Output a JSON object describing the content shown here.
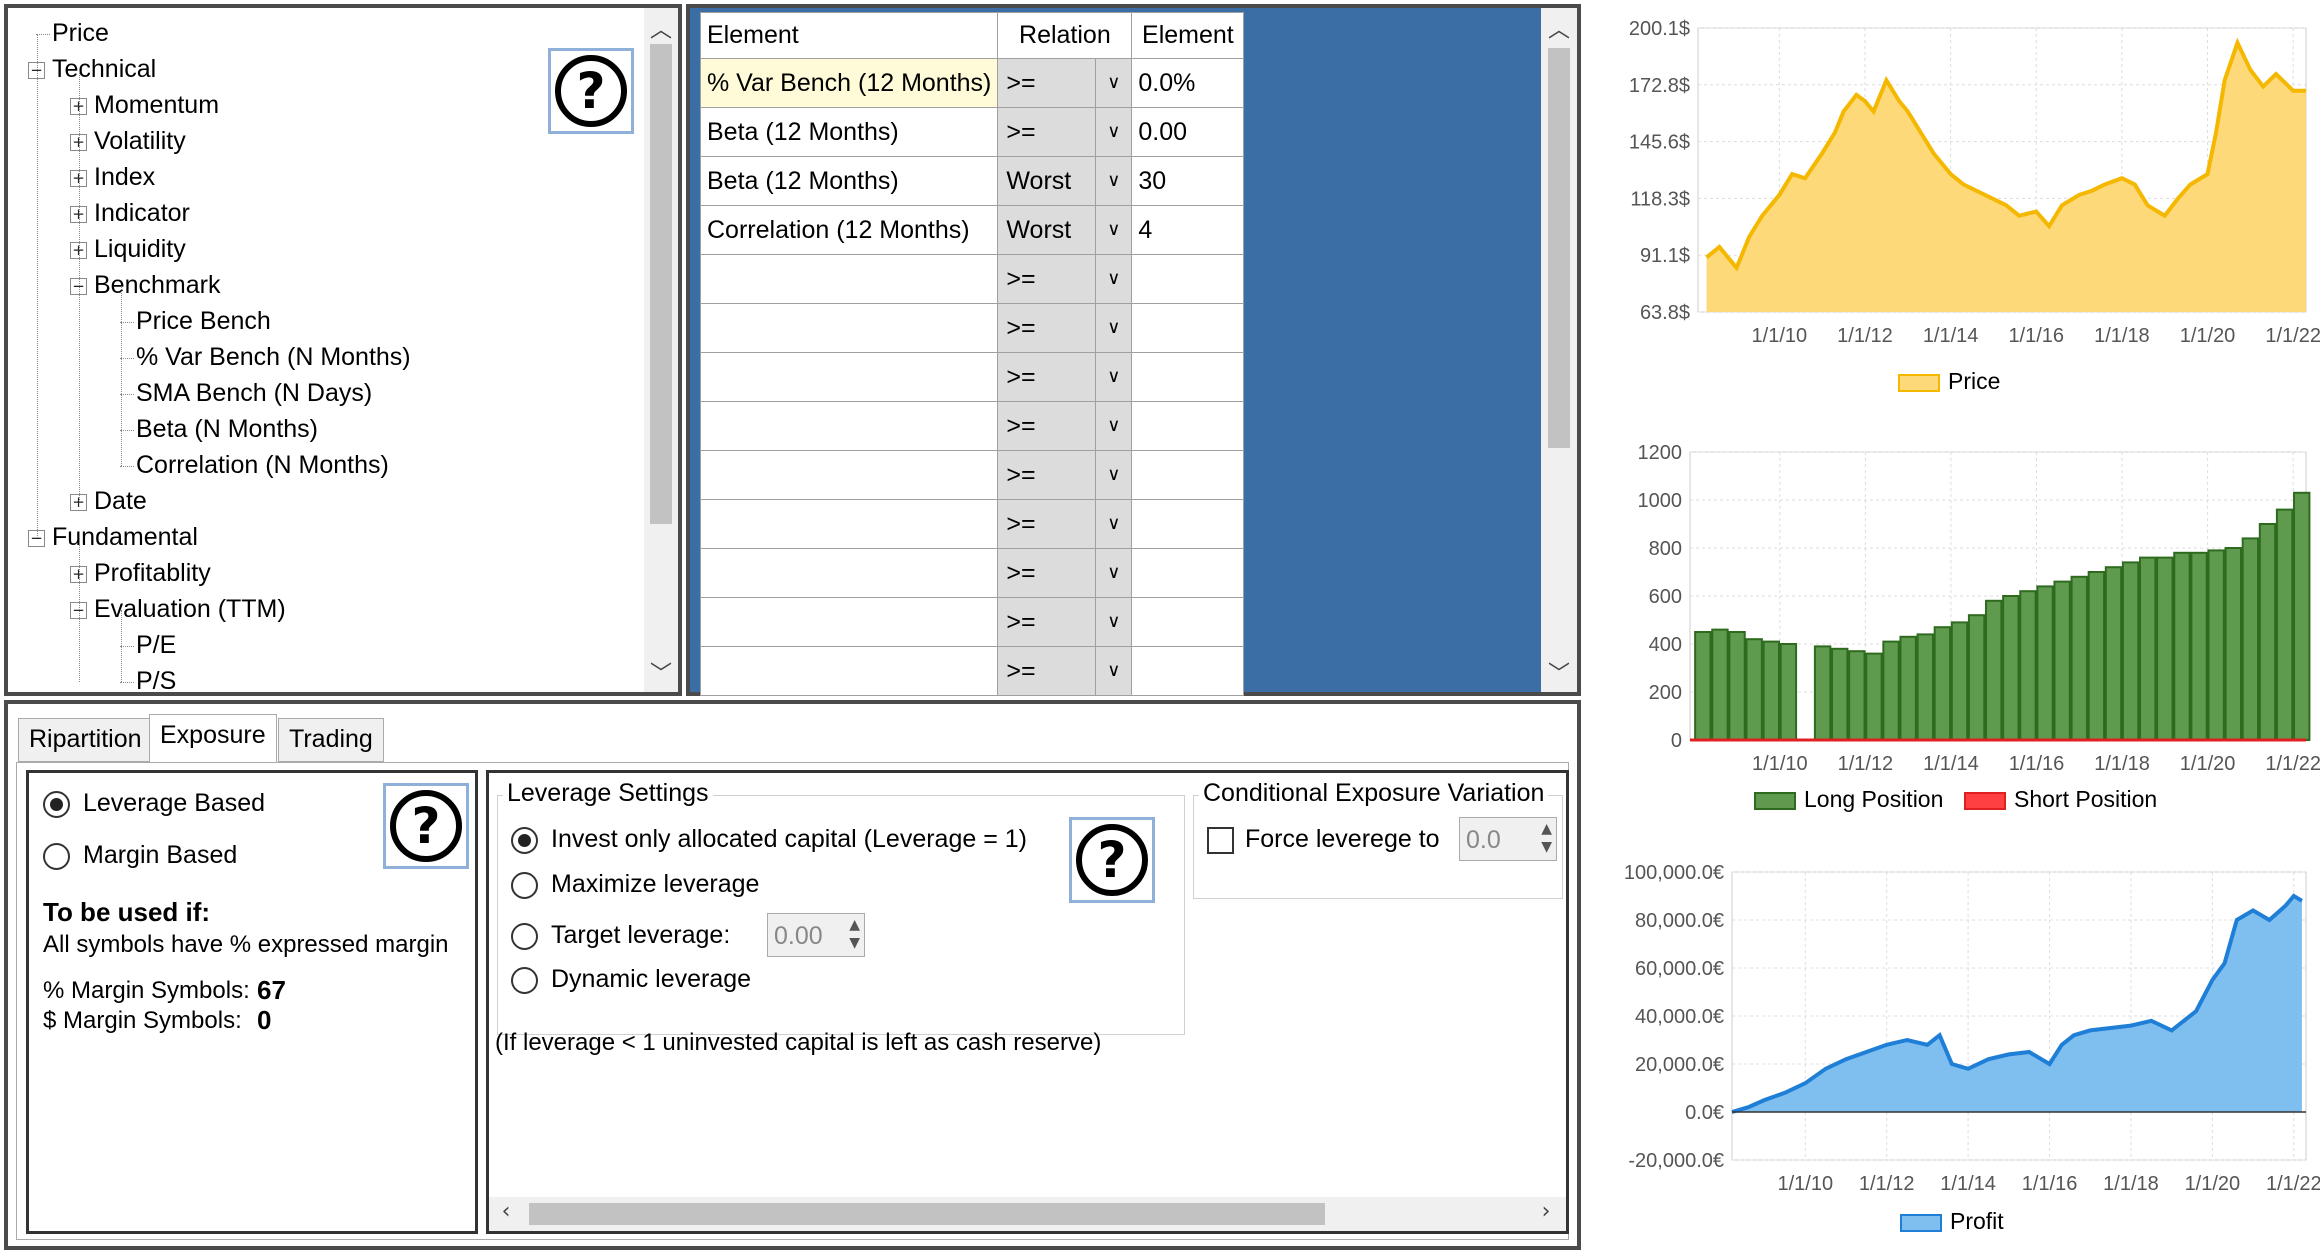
{
  "tree": {
    "items": [
      {
        "label": "Price",
        "level": 0,
        "expander": "none"
      },
      {
        "label": "Technical",
        "level": 0,
        "expander": "minus"
      },
      {
        "label": "Momentum",
        "level": 1,
        "expander": "plus"
      },
      {
        "label": "Volatility",
        "level": 1,
        "expander": "plus"
      },
      {
        "label": "Index",
        "level": 1,
        "expander": "plus"
      },
      {
        "label": "Indicator",
        "level": 1,
        "expander": "plus"
      },
      {
        "label": "Liquidity",
        "level": 1,
        "expander": "plus"
      },
      {
        "label": "Benchmark",
        "level": 1,
        "expander": "minus"
      },
      {
        "label": "Price Bench",
        "level": 2,
        "expander": "none"
      },
      {
        "label": "% Var Bench (N Months)",
        "level": 2,
        "expander": "none"
      },
      {
        "label": "SMA Bench (N Days)",
        "level": 2,
        "expander": "none"
      },
      {
        "label": "Beta (N Months)",
        "level": 2,
        "expander": "none"
      },
      {
        "label": "Correlation (N Months)",
        "level": 2,
        "expander": "none"
      },
      {
        "label": "Date",
        "level": 1,
        "expander": "plus"
      },
      {
        "label": "Fundamental",
        "level": 0,
        "expander": "minus"
      },
      {
        "label": "Profitablity",
        "level": 1,
        "expander": "plus"
      },
      {
        "label": "Evaluation (TTM)",
        "level": 1,
        "expander": "minus"
      },
      {
        "label": "P/E",
        "level": 2,
        "expander": "none"
      },
      {
        "label": "P/S",
        "level": 2,
        "expander": "none"
      }
    ],
    "help": "?"
  },
  "grid": {
    "headers": [
      "Element",
      "Relation",
      "Element"
    ],
    "rows": [
      {
        "element": "% Var Bench (12 Months)",
        "relation": ">=",
        "value": "0.0%"
      },
      {
        "element": "Beta (12 Months)",
        "relation": ">=",
        "value": "0.00"
      },
      {
        "element": "Beta (12 Months)",
        "relation": "Worst",
        "value": "30"
      },
      {
        "element": "Correlation (12 Months)",
        "relation": "Worst",
        "value": "4"
      },
      {
        "element": "",
        "relation": ">=",
        "value": ""
      },
      {
        "element": "",
        "relation": ">=",
        "value": ""
      },
      {
        "element": "",
        "relation": ">=",
        "value": ""
      },
      {
        "element": "",
        "relation": ">=",
        "value": ""
      },
      {
        "element": "",
        "relation": ">=",
        "value": ""
      },
      {
        "element": "",
        "relation": ">=",
        "value": ""
      },
      {
        "element": "",
        "relation": ">=",
        "value": ""
      },
      {
        "element": "",
        "relation": ">=",
        "value": ""
      },
      {
        "element": "",
        "relation": ">=",
        "value": ""
      }
    ],
    "highlight_color": "#fffbd8",
    "bg_color": "#3a6ea5"
  },
  "tabs": [
    "Ripartition",
    "Exposure",
    "Trading"
  ],
  "exposure": {
    "mode_options": [
      {
        "label": "Leverage Based",
        "checked": true
      },
      {
        "label": "Margin Based",
        "checked": false
      }
    ],
    "to_be_used_title": "To be used if:",
    "to_be_used_text": "All symbols have % expressed margin",
    "pct_margin_label": "% Margin Symbols:",
    "pct_margin_value": "67",
    "usd_margin_label": "$ Margin Symbols:",
    "usd_margin_value": "0",
    "leverage_settings_title": "Leverage Settings",
    "leverage_options": [
      {
        "label": "Invest only allocated capital (Leverage = 1)",
        "checked": true
      },
      {
        "label": "Maximize leverage",
        "checked": false
      },
      {
        "label": "Target leverage:",
        "checked": false
      },
      {
        "label": "Dynamic leverage",
        "checked": false
      }
    ],
    "target_leverage_value": "0.00",
    "note": "(If leverage < 1 uninvested capital is left as cash reserve)",
    "conditional_title": "Conditional Exposure Variation",
    "force_leverage_label": "Force leverege to",
    "force_leverage_value": "0.0"
  },
  "charts_text": {
    "price_legend": "Price",
    "long_legend": "Long Position",
    "short_legend": "Short Position",
    "profit_legend": "Profit"
  },
  "chart_data": [
    {
      "type": "area",
      "x_ticks": [
        "1/1/10",
        "1/1/12",
        "1/1/14",
        "1/1/16",
        "1/1/18",
        "1/1/20",
        "1/1/22"
      ],
      "y_ticks": [
        "63.8$",
        "91.1$",
        "118.3$",
        "145.6$",
        "172.8$",
        "200.1$"
      ],
      "ylim": [
        63.8,
        200.1
      ],
      "series": [
        {
          "name": "Price",
          "color": "#f5b800",
          "fill": "#fdd97a",
          "x": [
            2008.3,
            2008.6,
            2009.0,
            2009.3,
            2009.6,
            2010.0,
            2010.3,
            2010.6,
            2011.0,
            2011.3,
            2011.5,
            2011.8,
            2012.0,
            2012.2,
            2012.5,
            2012.8,
            2013.0,
            2013.3,
            2013.6,
            2014.0,
            2014.3,
            2014.6,
            2015.0,
            2015.3,
            2015.6,
            2016.0,
            2016.3,
            2016.6,
            2017.0,
            2017.3,
            2017.6,
            2018.0,
            2018.3,
            2018.6,
            2019.0,
            2019.3,
            2019.6,
            2020.0,
            2020.2,
            2020.4,
            2020.7,
            2021.0,
            2021.3,
            2021.6,
            2022.0,
            2022.3
          ],
          "y": [
            90,
            95,
            85,
            100,
            110,
            120,
            130,
            128,
            140,
            150,
            160,
            168,
            165,
            160,
            175,
            165,
            160,
            150,
            140,
            130,
            125,
            122,
            118,
            115,
            110,
            112,
            105,
            115,
            120,
            122,
            125,
            128,
            125,
            115,
            110,
            118,
            125,
            130,
            150,
            175,
            193,
            180,
            172,
            178,
            170,
            170
          ]
        }
      ]
    },
    {
      "type": "bar",
      "x_ticks": [
        "1/1/10",
        "1/1/12",
        "1/1/14",
        "1/1/16",
        "1/1/18",
        "1/1/20",
        "1/1/22"
      ],
      "y_ticks": [
        "0",
        "200",
        "400",
        "600",
        "800",
        "1000",
        "1200"
      ],
      "ylim": [
        0,
        1200
      ],
      "series": [
        {
          "name": "Long Position",
          "color": "#2e6b1e",
          "fill": "#5f9a4f",
          "x": [
            2008.2,
            2008.6,
            2009.0,
            2009.4,
            2009.8,
            2010.2,
            2011.0,
            2011.4,
            2011.8,
            2012.2,
            2012.6,
            2013.0,
            2013.4,
            2013.8,
            2014.2,
            2014.6,
            2015.0,
            2015.4,
            2015.8,
            2016.2,
            2016.6,
            2017.0,
            2017.4,
            2017.8,
            2018.2,
            2018.6,
            2019.0,
            2019.4,
            2019.8,
            2020.2,
            2020.6,
            2021.0,
            2021.4,
            2021.8,
            2022.2
          ],
          "y": [
            450,
            460,
            450,
            420,
            410,
            400,
            390,
            380,
            370,
            360,
            410,
            430,
            440,
            470,
            490,
            520,
            580,
            600,
            620,
            640,
            660,
            680,
            700,
            720,
            740,
            760,
            760,
            780,
            780,
            790,
            800,
            840,
            900,
            960,
            1030
          ]
        },
        {
          "name": "Short Position",
          "color": "#e02020",
          "fill": "#ff4040",
          "x": [],
          "y": []
        }
      ]
    },
    {
      "type": "area",
      "x_ticks": [
        "1/1/10",
        "1/1/12",
        "1/1/14",
        "1/1/16",
        "1/1/18",
        "1/1/20",
        "1/1/22"
      ],
      "y_ticks": [
        "-20,000.0€",
        "0.0€",
        "20,000.0€",
        "40,000.0€",
        "60,000.0€",
        "80,000.0€",
        "100,000.0€"
      ],
      "ylim": [
        -20000,
        100000
      ],
      "series": [
        {
          "name": "Profit",
          "color": "#1f7fd6",
          "fill": "#7fbff0",
          "x": [
            2008.2,
            2008.6,
            2009.0,
            2009.5,
            2010.0,
            2010.5,
            2011.0,
            2011.5,
            2012.0,
            2012.5,
            2013.0,
            2013.3,
            2013.6,
            2014.0,
            2014.5,
            2015.0,
            2015.5,
            2016.0,
            2016.3,
            2016.6,
            2017.0,
            2017.5,
            2018.0,
            2018.5,
            2019.0,
            2019.3,
            2019.6,
            2020.0,
            2020.3,
            2020.6,
            2021.0,
            2021.4,
            2021.8,
            2022.0,
            2022.2
          ],
          "y": [
            0,
            2000,
            5000,
            8000,
            12000,
            18000,
            22000,
            25000,
            28000,
            30000,
            28000,
            32000,
            20000,
            18000,
            22000,
            24000,
            25000,
            20000,
            28000,
            32000,
            34000,
            35000,
            36000,
            38000,
            34000,
            38000,
            42000,
            55000,
            62000,
            80000,
            84000,
            80000,
            86000,
            90000,
            88000
          ]
        }
      ]
    }
  ]
}
